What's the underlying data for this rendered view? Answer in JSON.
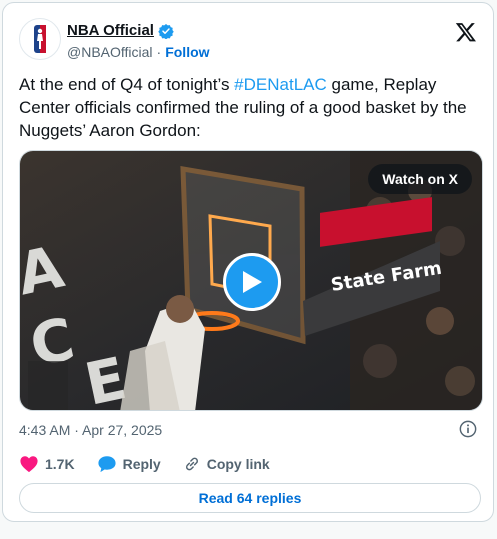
{
  "author": {
    "name": "NBA Official",
    "handle": "@NBAOfficial",
    "separator": "·",
    "follow_label": "Follow"
  },
  "post": {
    "text_before": "At the end of Q4 of tonight’s ",
    "hashtag": "#DENatLAC",
    "text_after": " game, Replay Center officials confirmed the ruling of a good basket by the Nuggets’ Aaron Gordon:"
  },
  "media": {
    "watch_label": "Watch on X",
    "sponsor_text": "State Farm"
  },
  "meta": {
    "timestamp": "4:43 AM · Apr 27, 2025"
  },
  "actions": {
    "likes": "1.7K",
    "reply_label": "Reply",
    "copy_link_label": "Copy link"
  },
  "read_replies_label": "Read 64 replies",
  "colors": {
    "accent": "#1d9bf0",
    "link": "#006fd6",
    "like": "#f91880",
    "verified": "#1d9bf0"
  }
}
